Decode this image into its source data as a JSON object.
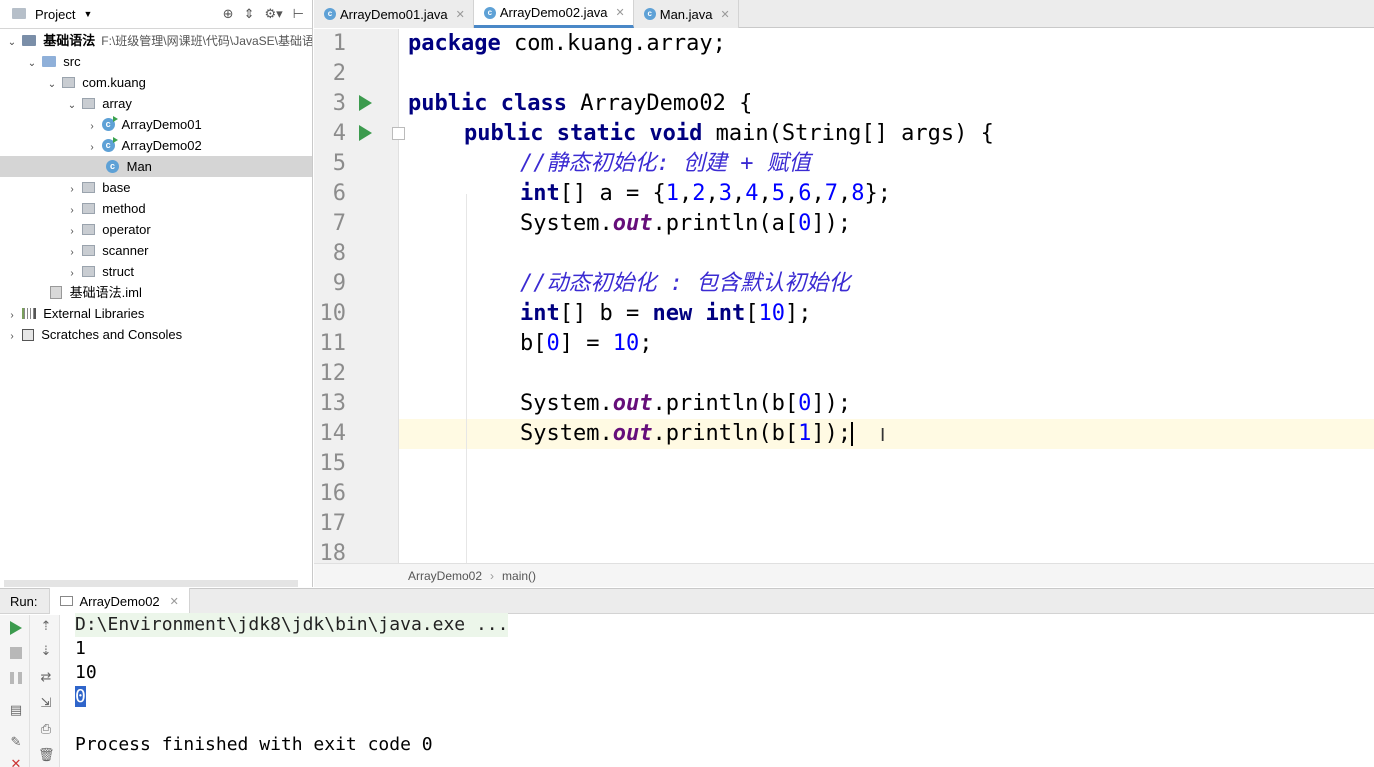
{
  "project": {
    "title": "Project",
    "tree": [
      {
        "label": "基础语法",
        "path": "F:\\班级管理\\网课班\\代码\\JavaSE\\基础语"
      },
      {
        "label": "src"
      },
      {
        "label": "com.kuang"
      },
      {
        "label": "array"
      },
      {
        "label": "ArrayDemo01"
      },
      {
        "label": "ArrayDemo02"
      },
      {
        "label": "Man"
      },
      {
        "label": "base"
      },
      {
        "label": "method"
      },
      {
        "label": "operator"
      },
      {
        "label": "scanner"
      },
      {
        "label": "struct"
      },
      {
        "label": "基础语法.iml"
      },
      {
        "label": "External Libraries"
      },
      {
        "label": "Scratches and Consoles"
      }
    ]
  },
  "tabs": [
    {
      "label": "ArrayDemo01.java"
    },
    {
      "label": "ArrayDemo02.java"
    },
    {
      "label": "Man.java"
    }
  ],
  "editor": {
    "line_numbers": [
      "1",
      "2",
      "3",
      "4",
      "5",
      "6",
      "7",
      "8",
      "9",
      "10",
      "11",
      "12",
      "13",
      "14",
      "15",
      "16",
      "17",
      "18"
    ],
    "code": {
      "l1_kw": "package",
      "l1_rest": " com.kuang.array;",
      "l3_kw": "public class",
      "l3_rest": " ArrayDemo02 {",
      "l4_kw": "public static void",
      "l4_rest": " main(String[] args) {",
      "l5_comment": "//静态初始化: 创建 + 赋值",
      "l6_kw": "int",
      "l6_a": "[] a = {",
      "l6_nums": [
        "1",
        "2",
        "3",
        "4",
        "5",
        "6",
        "7",
        "8"
      ],
      "l6_end": "};",
      "l7_a": "System.",
      "l7_out": "out",
      "l7_b": ".println(a[",
      "l7_idx": "0",
      "l7_c": "]);",
      "l9_comment": "//动态初始化 : 包含默认初始化",
      "l10_kw1": "int",
      "l10_a": "[] b = ",
      "l10_kw2": "new",
      "l10_kw3": "int",
      "l10_b": "[",
      "l10_num": "10",
      "l10_c": "];",
      "l11_a": "b[",
      "l11_idx": "0",
      "l11_b": "] = ",
      "l11_num": "10",
      "l11_c": ";",
      "l13_a": "System.",
      "l13_out": "out",
      "l13_b": ".println(b[",
      "l13_idx": "0",
      "l13_c": "]);",
      "l14_a": "System.",
      "l14_out": "out",
      "l14_b": ".println(b[",
      "l14_idx": "1",
      "l14_c": "]);"
    }
  },
  "breadcrumb": {
    "class": "ArrayDemo02",
    "method": "main()"
  },
  "run": {
    "label": "Run:",
    "tab": "ArrayDemo02",
    "output": [
      "D:\\Environment\\jdk8\\jdk\\bin\\java.exe ...",
      "1",
      "10",
      "0",
      "",
      "Process finished with exit code 0"
    ]
  },
  "colors": {
    "keyword": "#000080",
    "comment": "#3b2bd2",
    "number": "#0000ff",
    "static_field": "#660e7a",
    "run_green": "#3c9b4e"
  }
}
